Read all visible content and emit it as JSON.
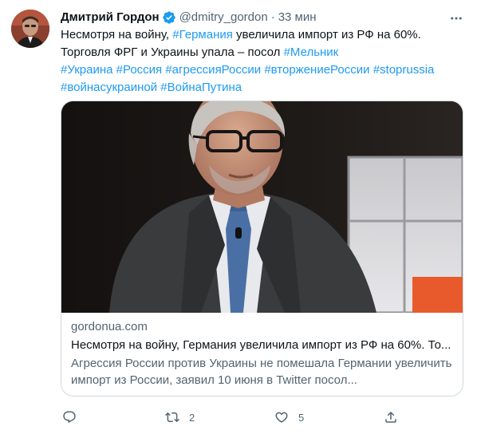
{
  "author": {
    "display_name": "Дмитрий Гордон",
    "handle": "@dmitry_gordon",
    "separator": "·",
    "time": "33 мин"
  },
  "tweet_text": {
    "line1_a": "Несмотря на войну, ",
    "line1_tag": "#Германия",
    "line1_b": " увеличила импорт из РФ на 60%.",
    "line2_a": "Торговля ФРГ и Украины упала – посол ",
    "line2_tag": "#Мельник",
    "hashtags_line3": [
      "#Украина",
      "#Россия",
      "#агрессияРоссии",
      "#вторжениеРоссии",
      "#stoprussia"
    ],
    "hashtags_line4": [
      "#войнасукраиной",
      "#ВойнаПутина"
    ]
  },
  "card": {
    "domain": "gordonua.com",
    "title": "Несмотря на войну, Германия увеличила импорт из РФ на 60%. То...",
    "description_line1": "Агрессия России против Украины не помешала Германии увеличить",
    "description_line2": "импорт из России, заявил 10 июня в Twitter посол..."
  },
  "actions": {
    "reply_count": "",
    "retweet_count": "2",
    "like_count": "5"
  },
  "icons": {
    "verified": "verified-badge-icon",
    "more": "more-options-icon",
    "reply": "reply-icon",
    "retweet": "retweet-icon",
    "like": "heart-icon",
    "share": "share-icon"
  },
  "colors": {
    "accent": "#1d9bf0",
    "text": "#0f1419",
    "secondary": "#536471",
    "border": "#cfd9de"
  }
}
